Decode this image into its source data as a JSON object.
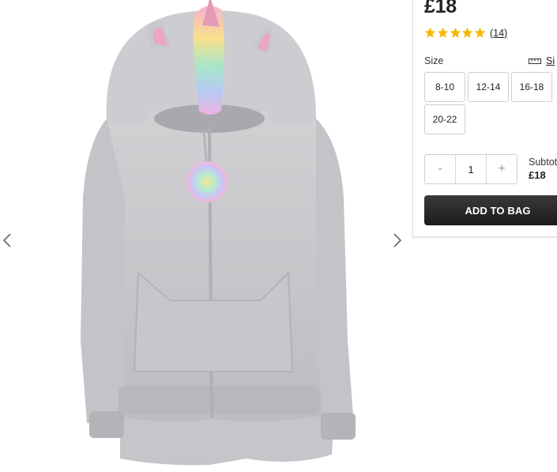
{
  "product": {
    "price": "£18",
    "rating": {
      "stars": 5,
      "review_count": "(14)"
    },
    "colors": {
      "star": "#f5b800",
      "button_bg": "#262626",
      "fur": "#c9c9cc"
    }
  },
  "gallery": {
    "prev_icon": "chevron-left-icon",
    "next_icon": "chevron-right-icon"
  },
  "size": {
    "label": "Size",
    "guide_label": "Si",
    "guide_icon": "ruler-icon",
    "options": [
      "8-10",
      "12-14",
      "16-18",
      "20-22"
    ]
  },
  "quantity": {
    "minus": "-",
    "value": "1",
    "plus": "+"
  },
  "subtotal": {
    "label": "Subtot",
    "value": "£18"
  },
  "cta": {
    "add_to_bag": "ADD TO BAG"
  }
}
